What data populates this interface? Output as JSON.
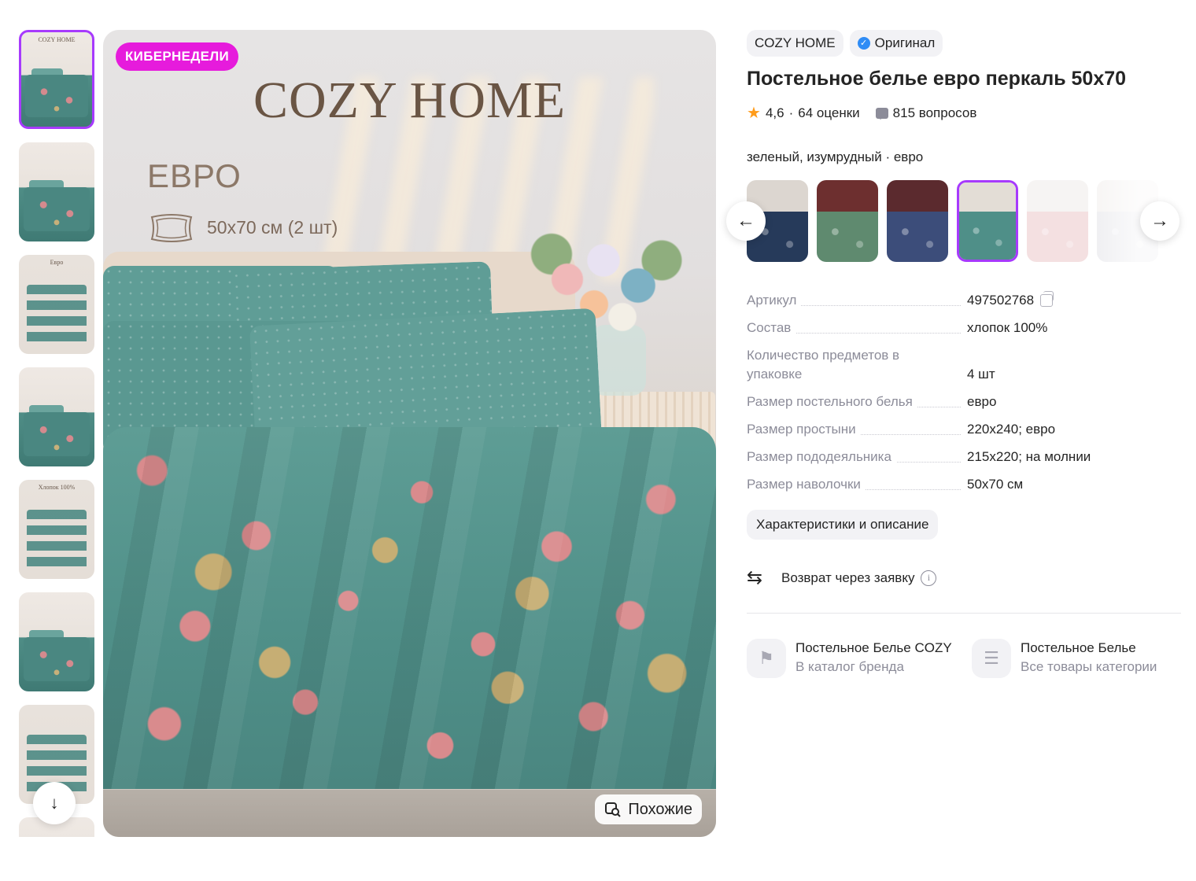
{
  "gallery": {
    "thumbnails": [
      {
        "kind": "photo",
        "caption": "COZY HOME"
      },
      {
        "kind": "photo",
        "caption": ""
      },
      {
        "kind": "info",
        "caption": "Евро"
      },
      {
        "kind": "photo",
        "caption": ""
      },
      {
        "kind": "info",
        "caption": "Хлопок 100%"
      },
      {
        "kind": "photo",
        "caption": ""
      },
      {
        "kind": "info",
        "caption": ""
      },
      {
        "kind": "photo",
        "caption": ""
      }
    ],
    "active_index": 0,
    "scroll_down_icon": "arrow-down-icon"
  },
  "main_image": {
    "promo_badge": "КИБЕРНЕДЕЛИ",
    "brand_text": "COZY HOME",
    "size_title": "ЕВРО",
    "size_note": "50х70 см (2 шт)",
    "similar_label": "Похожие",
    "colors": {
      "promo": "#e61bdc",
      "duvet": "#4f8f88"
    }
  },
  "product": {
    "brand_chip": "COZY HOME",
    "original_chip": "Оригинал",
    "title": "Постельное белье евро перкаль 50х70",
    "rating": "4,6",
    "separator": "·",
    "reviews": "64 оценки",
    "questions": "815 вопросов",
    "variant_label": "зеленый, изумрудный · евро",
    "variants": [
      {
        "name": "variant-navy",
        "top": "#dcd6d0",
        "bed": "#263a5a"
      },
      {
        "name": "variant-sage-christmas",
        "top": "#6d2f2f",
        "bed": "#5f8a6f"
      },
      {
        "name": "variant-blue-christmas",
        "top": "#5b2a2e",
        "bed": "#3c4d7a"
      },
      {
        "name": "variant-emerald",
        "top": "#e3ddd6",
        "bed": "#4f8f88"
      },
      {
        "name": "variant-pink-white",
        "top": "#f4f1ef",
        "bed": "#f1d6d8"
      },
      {
        "name": "variant-white",
        "top": "#f3f1ef",
        "bed": "#e8e8ec"
      }
    ],
    "active_variant": 3,
    "specs": [
      {
        "label": "Артикул",
        "value": "497502768",
        "copy": true
      },
      {
        "label": "Состав",
        "value": "хлопок 100%"
      },
      {
        "label": "Количество предметов в упаковке",
        "value": "4 шт",
        "multi": true
      },
      {
        "label": "Размер постельного белья",
        "value": "евро"
      },
      {
        "label": "Размер простыни",
        "value": "220х240; евро"
      },
      {
        "label": "Размер пододеяльника",
        "value": "215х220; на молнии"
      },
      {
        "label": "Размер наволочки",
        "value": "50х70 см"
      }
    ],
    "characteristics_button": "Характеристики и описание",
    "return_text": "Возврат через заявку",
    "links": [
      {
        "title": "Постельное Белье COZY HOME",
        "subtitle": "В каталог бренда",
        "icon": "tag-icon"
      },
      {
        "title": "Постельное Белье",
        "subtitle": "Все товары категории",
        "icon": "layers-icon"
      }
    ]
  }
}
